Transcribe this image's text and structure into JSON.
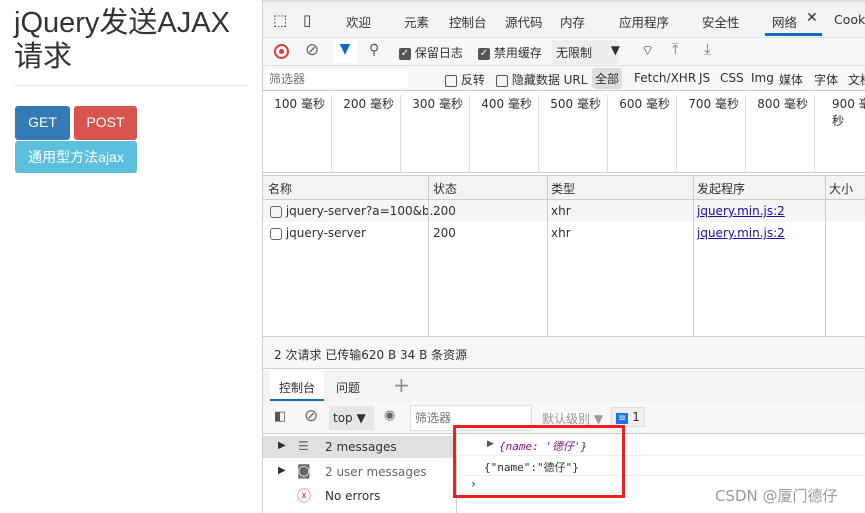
{
  "page": {
    "title": "jQuery发送AJAX请求",
    "buttons": {
      "get": "GET",
      "post": "POST",
      "ajax": "通用型方法ajax"
    },
    "colors": {
      "get": "#337ab7",
      "post": "#d9534f",
      "ajax": "#5bc0de"
    }
  },
  "devtools": {
    "tabs": [
      "欢迎",
      "元素",
      "控制台",
      "源代码",
      "内存",
      "应用程序",
      "安全性",
      "网络",
      "Cookie"
    ],
    "active_tab": "网络",
    "toolbar": {
      "preserve_log": "保留日志",
      "disable_cache": "禁用缓存",
      "throttle": "无限制"
    },
    "filter": {
      "placeholder": "筛选器",
      "invert": "反转",
      "hide_data_urls": "隐藏数据 URL",
      "types": [
        "全部",
        "Fetch/XHR",
        "JS",
        "CSS",
        "Img",
        "媒体",
        "字体",
        "文档"
      ]
    },
    "timeline": [
      "100 毫秒",
      "200 毫秒",
      "300 毫秒",
      "400 毫秒",
      "500 毫秒",
      "600 毫秒",
      "700 毫秒",
      "800 毫秒",
      "900 毫秒"
    ],
    "table": {
      "headers": [
        "名称",
        "状态",
        "类型",
        "发起程序",
        "大小"
      ],
      "rows": [
        {
          "name": "jquery-server?a=100&b...",
          "status": "200",
          "type": "xhr",
          "initiator": "jquery.min.js:2"
        },
        {
          "name": "jquery-server",
          "status": "200",
          "type": "xhr",
          "initiator": "jquery.min.js:2"
        }
      ]
    },
    "summary": "2 次请求  已传输620 B  34 B 条资源",
    "console": {
      "tabs": [
        "控制台",
        "问题"
      ],
      "context": "top",
      "filter_placeholder": "筛选器",
      "level": "默认级别",
      "issues_count": "1",
      "sidebar": [
        "2 messages",
        "2 user messages",
        "No errors"
      ],
      "logs": [
        "{name: '德仔'}",
        "{\"name\":\"德仔\"}"
      ]
    },
    "watermark": "CSDN @厦门德仔"
  }
}
